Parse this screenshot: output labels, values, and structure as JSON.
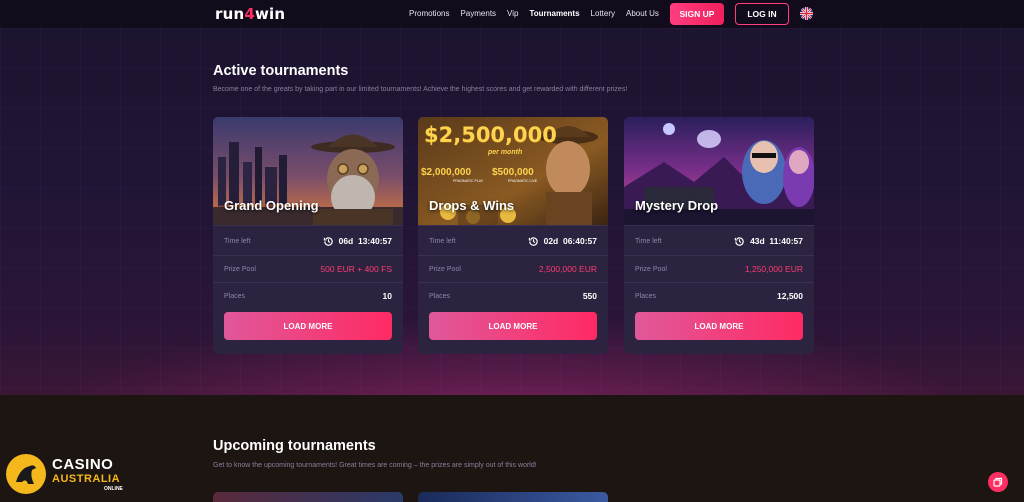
{
  "brand": {
    "logo_pre": "run",
    "logo_mid": "4",
    "logo_post": "win"
  },
  "nav": {
    "items": [
      {
        "label": "Promotions"
      },
      {
        "label": "Payments"
      },
      {
        "label": "Vip"
      },
      {
        "label": "Tournaments",
        "active": true
      },
      {
        "label": "Lottery"
      },
      {
        "label": "About Us"
      }
    ],
    "signup_label": "SIGN UP",
    "login_label": "LOG IN",
    "language_icon": "uk-flag-icon"
  },
  "active": {
    "title": "Active tournaments",
    "subtitle": "Become one of the greats by taking part in our limited tournaments! Achieve the highest scores and get rewarded with different prizes!"
  },
  "cards": [
    {
      "title": "Grand Opening",
      "time_label": "Time left",
      "time_value": "06d  13:40:57",
      "prize_label": "Prize Pool",
      "prize_value": "500 EUR + 400 FS",
      "places_label": "Places",
      "places_value": "10",
      "button": "LOAD MORE"
    },
    {
      "title": "Drops & Wins",
      "banner_amount": "$2,500,000",
      "banner_period": "per month",
      "banner_left": "$2,000,000",
      "banner_left_sub": "PRAGMATIC PLAY",
      "banner_right": "$500,000",
      "banner_right_sub": "PRAGMATIC LIVE",
      "time_label": "Time left",
      "time_value": "02d  06:40:57",
      "prize_label": "Prize Pool",
      "prize_value": "2,500,000 EUR",
      "places_label": "Places",
      "places_value": "550",
      "button": "LOAD MORE"
    },
    {
      "title": "Mystery Drop",
      "time_label": "Time left",
      "time_value": "43d  11:40:57",
      "prize_label": "Prize Pool",
      "prize_value": "1,250,000 EUR",
      "places_label": "Places",
      "places_value": "12,500",
      "button": "LOAD MORE"
    }
  ],
  "upcoming": {
    "title": "Upcoming tournaments",
    "subtitle": "Get to know the upcoming tournaments! Great times are coming – the prizes are simply out of this world!"
  },
  "watermark": {
    "line1": "CASINO",
    "line2": "AUSTRALIA",
    "line3": "ONLINE"
  },
  "colors": {
    "accent": "#ff2e63",
    "prize": "#ff3d6f",
    "card_bg": "#2b2340"
  }
}
